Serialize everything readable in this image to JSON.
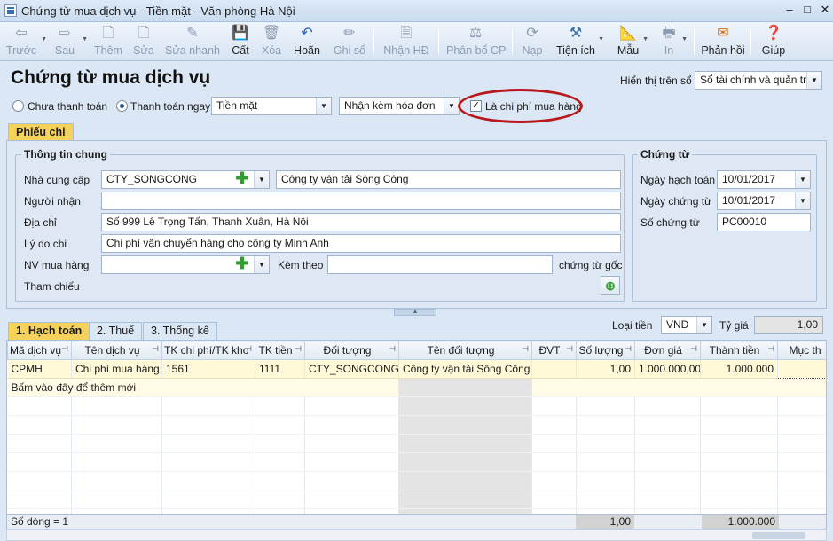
{
  "window": {
    "title": "Chứng từ mua dịch vụ - Tiền mặt - Văn phòng Hà Nội",
    "controls": {
      "minimize": "–",
      "maximize": "□",
      "close": "✕"
    }
  },
  "toolbar": {
    "back": "Trước",
    "next": "Sau",
    "add": "Thêm",
    "edit": "Sửa",
    "quick_edit": "Sửa nhanh",
    "save": "Cất",
    "delete": "Xóa",
    "undo": "Hoãn",
    "post": "Ghi sổ",
    "receive_invoice": "Nhận HĐ",
    "allocate_cost": "Phân bổ CP",
    "load": "Nạp",
    "utilities": "Tiện ích",
    "template": "Mẫu",
    "print": "In",
    "feedback": "Phản hồi",
    "help": "Giúp"
  },
  "header": {
    "page_title": "Chứng từ mua dịch vụ",
    "show_on_book_label": "Hiển thị trên sổ",
    "show_on_book_value": "Sổ tài chính và quản trị",
    "unpaid_label": "Chưa thanh toán",
    "pay_now_label": "Thanh toán ngay",
    "payment_method": "Tiền mặt",
    "invoice_option": "Nhận kèm hóa đơn",
    "purchase_cost_label": "Là chi phí mua hàng",
    "purchase_cost_checked": true
  },
  "tabs": {
    "payment_voucher": "Phiếu chi"
  },
  "general_info": {
    "title": "Thông tin chung",
    "supplier_label": "Nhà cung cấp",
    "supplier_code": "CTY_SONGCONG",
    "supplier_name": "Công ty vận tải Sông Công",
    "receiver_label": "Người nhận",
    "receiver_value": "",
    "address_label": "Địa chỉ",
    "address_value": "Số 999 Lê Trọng Tấn, Thanh Xuân, Hà Nội",
    "reason_label": "Lý do chi",
    "reason_value": "Chi phí vận chuyển hàng cho công ty Minh Anh",
    "buyer_label": "NV mua hàng",
    "buyer_value": "",
    "attach_label": "Kèm theo",
    "attach_value": "",
    "original_docs_label": "chứng từ gốc",
    "reference_label": "Tham chiếu"
  },
  "voucher": {
    "title": "Chứng từ",
    "posting_date_label": "Ngày hạch toán",
    "posting_date": "10/01/2017",
    "voucher_date_label": "Ngày chứng từ",
    "voucher_date": "10/01/2017",
    "voucher_no_label": "Số chứng từ",
    "voucher_no": "PC00010"
  },
  "detail_tabs": {
    "accounting": "1. Hạch toán",
    "tax": "2. Thuế",
    "statistics": "3. Thống kê"
  },
  "currency": {
    "label": "Loại tiền",
    "value": "VND",
    "rate_label": "Tỷ giá",
    "rate_value": "1,00"
  },
  "grid": {
    "columns": [
      "Mã dịch vụ",
      "Tên dịch vụ",
      "TK chi phí/TK kho",
      "TK tiền",
      "Đối tượng",
      "Tên đối tượng",
      "ĐVT",
      "Số lượng",
      "Đơn giá",
      "Thành tiền",
      "Mục th"
    ],
    "rows": [
      [
        "CPMH",
        "Chi phí mua hàng",
        "1561",
        "1111",
        "CTY_SONGCONG",
        "Công ty vận tải Sông Công",
        "",
        "1,00",
        "1.000.000,00",
        "1.000.000",
        ""
      ]
    ],
    "add_row_hint": "Bấm vào đây để thêm mới"
  },
  "footer": {
    "row_count": "Số dòng = 1",
    "total_quantity": "1,00",
    "total_amount": "1.000.000"
  },
  "colors": {
    "accent_tab": "#f6d25b",
    "highlight_ring": "#b8171c",
    "background": "#dbe7f4"
  }
}
